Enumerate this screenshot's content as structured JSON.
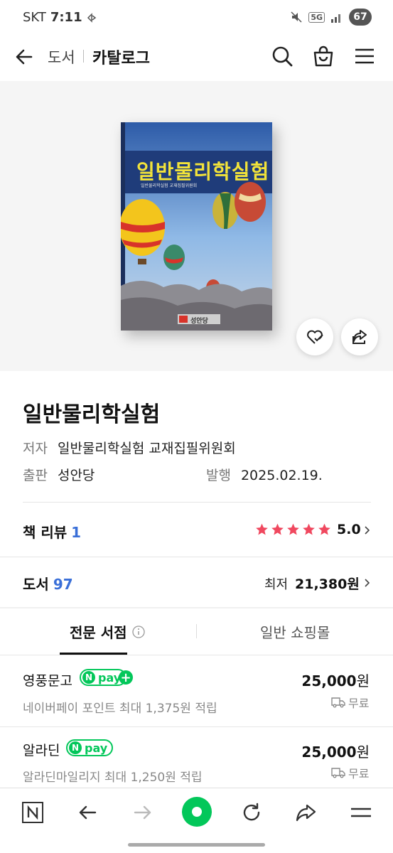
{
  "status_bar": {
    "carrier": "SKT",
    "time": "7:11",
    "network": "5G",
    "battery": "67"
  },
  "header": {
    "back_label": "back",
    "breadcrumb_1": "도서",
    "breadcrumb_2": "카탈로그",
    "icons": [
      "search-icon",
      "cart-icon",
      "menu-icon"
    ]
  },
  "book": {
    "cover_title": "일반물리학실험",
    "cover_subtitle": "일반물리학실험 교재집필위원회",
    "cover_publisher": "성안당",
    "title": "일반물리학실험",
    "author_label": "저자",
    "author": "일반물리학실험 교재집필위원회",
    "publisher_label": "출판",
    "publisher": "성안당",
    "date_label": "발행",
    "date": "2025.02.19."
  },
  "review": {
    "label": "책 리뷰",
    "count": "1",
    "rating": "5.0",
    "stars": 5
  },
  "books": {
    "label": "도서",
    "count": "97",
    "lowest_label": "최저",
    "lowest_price": "21,380원"
  },
  "tabs": {
    "tab1": "전문 서점",
    "tab2": "일반 쇼핑몰",
    "active": 0
  },
  "sellers": [
    {
      "name": "영풍문고",
      "price": "25,000",
      "won": "원",
      "note": "네이버페이 포인트 최대 1,375원 적립",
      "shipping": "무료",
      "npay_plus": true
    },
    {
      "name": "알라딘",
      "price": "25,000",
      "won": "원",
      "note": "알라딘마일리지 최대 1,250원 적립",
      "shipping": "무료",
      "npay_plus": false
    }
  ],
  "npay": {
    "n": "N",
    "pay": "pay",
    "plus": "+"
  },
  "colors": {
    "npay_green": "#03c75a",
    "accent_blue": "#3a6fd8",
    "star_red": "#f0485f",
    "cover_navy": "#1f3c7a",
    "cover_title_yellow": "#f2e33a"
  }
}
